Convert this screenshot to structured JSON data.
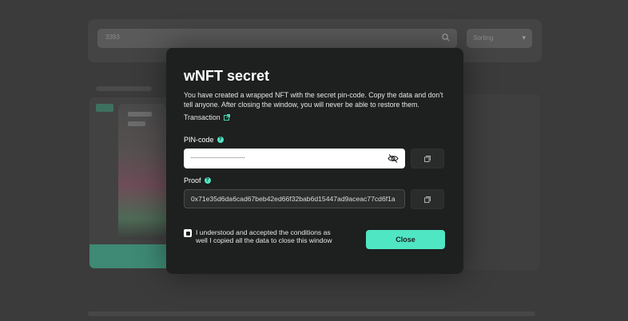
{
  "background": {
    "search": {
      "value": "3393"
    },
    "sort_select": {
      "value": "Sorting"
    }
  },
  "modal": {
    "title": "wNFT secret",
    "description": "You have created a wrapped NFT with the secret pin-code. Copy the data and don't tell anyone. After closing the window, you will never be able to restore them.",
    "transaction_link": "Transaction",
    "pin": {
      "label": "PIN-code",
      "value": "··································"
    },
    "proof": {
      "label": "Proof",
      "value": "0x71e35d6da6cad67beb42ed66f32bab6d15447ad9aceac77cd6f1a"
    },
    "confirm_label": "I understood and accepted the conditions as well I copied all the data to close this window",
    "close_label": "Close"
  },
  "colors": {
    "accent": "#4fe6c3",
    "modal_bg": "#1e1f1f",
    "overlay_bg": "#3b3b3b"
  },
  "icons": [
    "search-icon",
    "chevron-down-icon",
    "external-link-icon",
    "help-icon",
    "eye-off-icon",
    "copy-icon"
  ]
}
